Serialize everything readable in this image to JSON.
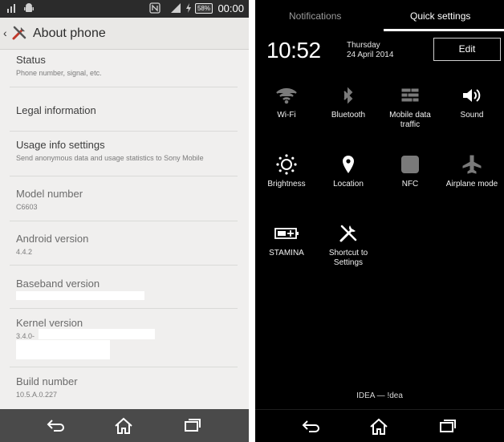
{
  "left": {
    "status_bar": {
      "time": "00:00",
      "battery": "58%"
    },
    "app_bar": {
      "title": "About phone"
    },
    "items": [
      {
        "title": "Status",
        "subtitle": "Phone number, signal, etc."
      },
      {
        "title": "Legal information",
        "subtitle": ""
      },
      {
        "title": "Usage info settings",
        "subtitle": "Send anonymous data and usage statistics to Sony Mobile"
      },
      {
        "title": "Model number",
        "subtitle": "C6603"
      },
      {
        "title": "Android version",
        "subtitle": "4.4.2"
      },
      {
        "title": "Baseband version",
        "subtitle": ""
      },
      {
        "title": "Kernel version",
        "subtitle": "3.4.0-"
      },
      {
        "title": "Build number",
        "subtitle": "10.5.A.0.227"
      }
    ]
  },
  "right": {
    "tabs": {
      "notifications": "Notifications",
      "quick_settings": "Quick settings"
    },
    "clock": "10:52",
    "day": "Thursday",
    "date": "24 April 2014",
    "edit_label": "Edit",
    "tiles": [
      {
        "label": "Wi-Fi",
        "icon": "wifi-icon",
        "state": "off"
      },
      {
        "label": "Bluetooth",
        "icon": "bluetooth-icon",
        "state": "off"
      },
      {
        "label": "Mobile data traffic",
        "icon": "mobile-data-icon",
        "state": "off"
      },
      {
        "label": "Sound",
        "icon": "sound-icon",
        "state": "on"
      },
      {
        "label": "Brightness",
        "icon": "brightness-icon",
        "state": "on"
      },
      {
        "label": "Location",
        "icon": "location-icon",
        "state": "on"
      },
      {
        "label": "NFC",
        "icon": "nfc-icon",
        "state": "off"
      },
      {
        "label": "Airplane mode",
        "icon": "airplane-icon",
        "state": "off"
      },
      {
        "label": "STAMINA",
        "icon": "stamina-battery-icon",
        "state": "on"
      },
      {
        "label": "Shortcut to Settings",
        "icon": "settings-tools-icon",
        "state": "on"
      }
    ],
    "carrier": "IDEA — !dea"
  },
  "colors": {
    "left_bg": "#f0efee",
    "status_bar": "#2b2b2b",
    "nav_left": "#4a4a4a",
    "right_bg": "#000000"
  }
}
